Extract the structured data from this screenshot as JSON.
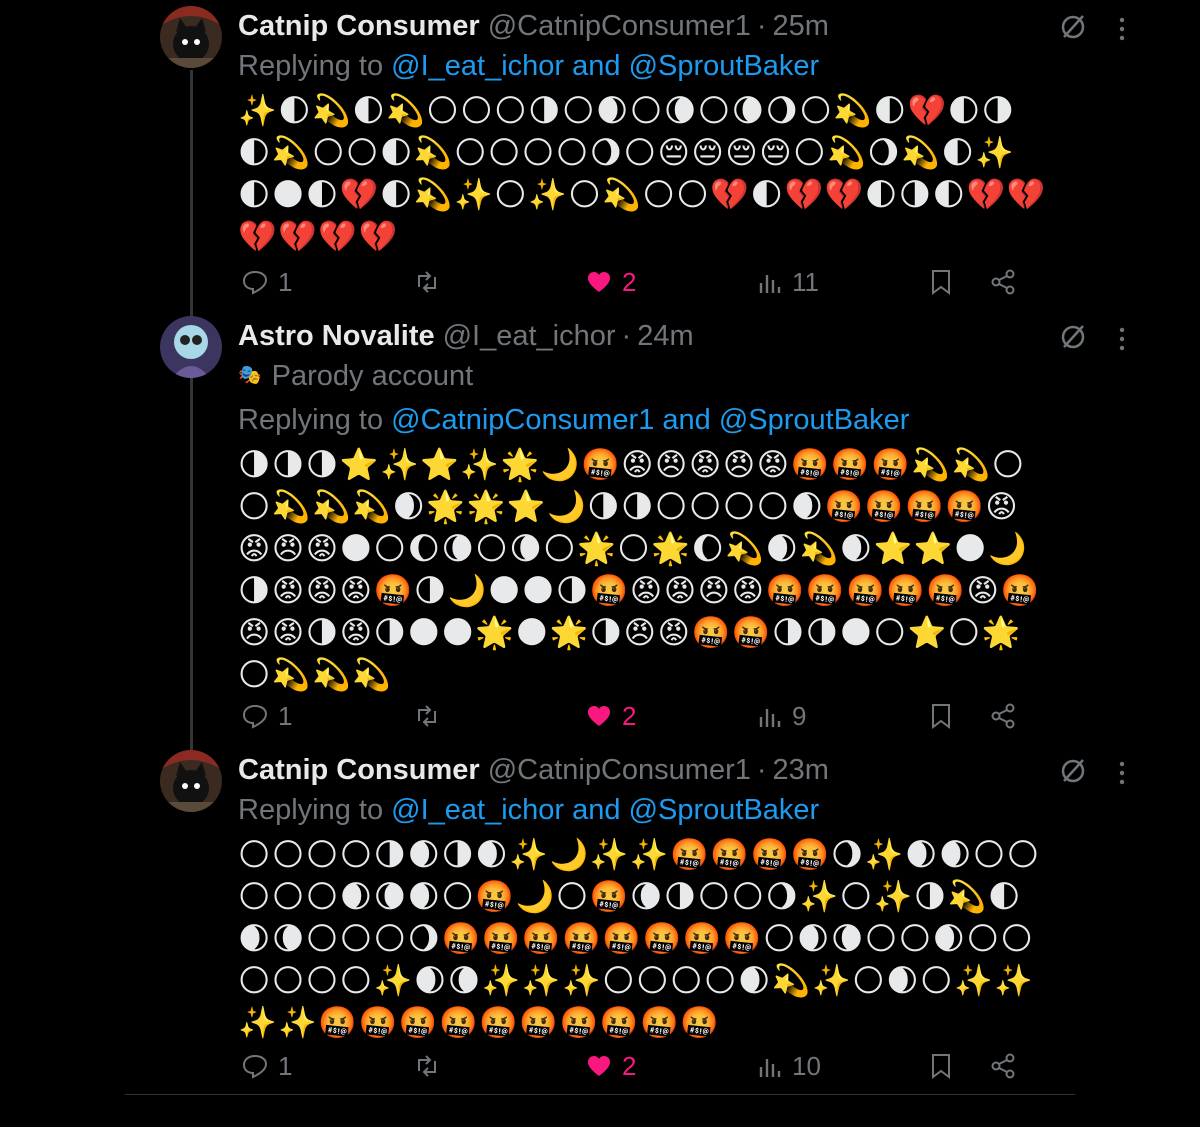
{
  "tweets": [
    {
      "name": "Catnip Consumer",
      "handle": "@CatnipConsumer1",
      "time": "25m",
      "replying_prefix": "Replying to ",
      "replying_to": "@I_eat_ichor and @SproutBaker",
      "emoji_text": "✨🌓💫🌓💫🌕🌕🌕🌗🌕🌒🌕🌘🌕🌘🌖🌕💫🌓💔🌓🌗🌓💫🌕🌕🌓💫🌕🌕🌕🌕🌖🌕😔😔😔😔🌕💫🌖💫🌓✨🌓🌑🌓💔🌓💫✨🌕✨🌕💫🌕🌕💔🌓💔💔🌓🌗🌓💔💔💔💔💔💔",
      "replies": "1",
      "retweets": "",
      "likes": "2",
      "views": "11"
    },
    {
      "name": "Astro Novalite",
      "handle": "@I_eat_ichor",
      "time": "24m",
      "parody_icon": "🎭",
      "parody_label": "Parody account",
      "replying_prefix": "Replying to ",
      "replying_to": "@CatnipConsumer1 and @SproutBaker",
      "emoji_text": "🌗🌗🌗⭐✨⭐✨🌟🌙🤬😡😠😡😠😡🤬🤬🤬💫💫🌕🌕💫💫💫🌒🌟🌟⭐🌙🌗🌗🌕🌕🌕🌕🌒🤬🤬🤬🤬😡😡😠😡🌑🌕🌔🌘🌕🌘🌕🌟🌕🌟🌔💫🌒💫🌒⭐⭐🌑🌙🌗😡😡😡🤬🌗🌙🌑🌑🌗🤬😡😡😠😡🤬🤬🤬🤬🤬😡🤬😠😡🌗😡🌗🌑🌑🌟🌑🌟🌗😠😡🤬🤬🌗🌗🌑🌕⭐🌕🌟🌕💫💫💫",
      "replies": "1",
      "retweets": "",
      "likes": "2",
      "views": "9"
    },
    {
      "name": "Catnip Consumer",
      "handle": "@CatnipConsumer1",
      "time": "23m",
      "replying_prefix": "Replying to ",
      "replying_to": "@I_eat_ichor and @SproutBaker",
      "emoji_text": "🌕🌕🌕🌕🌗🌒🌗🌒✨🌙✨✨🤬🤬🤬🤬🌖✨🌒🌒🌕🌕🌕🌕🌕🌒🌘🌒🌕🤬🌙🌕🤬🌘🌗🌕🌕🌖✨🌕✨🌗💫🌓🌒🌘🌕🌕🌕🌖🤬🤬🤬🤬🤬🤬🤬🤬🌕🌒🌘🌕🌕🌒🌕🌕🌕🌕🌕🌕✨🌒🌘✨✨✨🌕🌕🌕🌕🌒💫✨🌕🌒🌕✨✨✨✨🤬🤬🤬🤬🤬🤬🤬🤬🤬🤬",
      "replies": "1",
      "retweets": "",
      "likes": "2",
      "views": "10"
    }
  ],
  "colors": {
    "background": "#000000",
    "text": "#e7e9ea",
    "muted": "#71767b",
    "link": "#1d9bf0",
    "like": "#f91880",
    "divider": "#2f3336"
  },
  "icons": [
    "reply-icon",
    "retweet-icon",
    "heart-icon",
    "views-icon",
    "bookmark-icon",
    "share-icon",
    "grok-icon",
    "more-icon"
  ]
}
